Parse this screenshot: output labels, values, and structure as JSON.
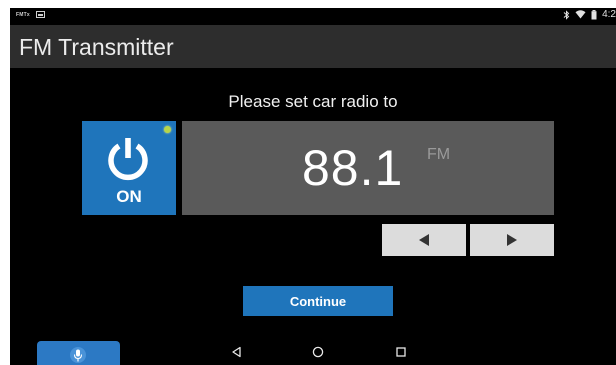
{
  "status_bar": {
    "left_tag": "FMTx",
    "time": "4:2",
    "icons": [
      "notification-tag",
      "image-icon",
      "bluetooth-icon",
      "wifi-icon",
      "battery-icon"
    ]
  },
  "app_bar": {
    "title": "FM Transmitter"
  },
  "main": {
    "prompt": "Please set car radio to",
    "power": {
      "state_label": "ON",
      "icon": "power-icon",
      "indicator_color": "#b6d54a"
    },
    "frequency": {
      "value": "88.1",
      "unit": "FM"
    },
    "tune_down_icon": "triangle-left-icon",
    "tune_up_icon": "triangle-right-icon",
    "continue_label": "Continue"
  },
  "bottom": {
    "mic_icon": "microphone-icon",
    "nav": [
      "back-icon",
      "home-icon",
      "recent-apps-icon"
    ]
  },
  "colors": {
    "accent": "#1f75bb",
    "panel": "#5a5a5a",
    "app_bar": "#2d2d2d",
    "background": "#000000"
  }
}
